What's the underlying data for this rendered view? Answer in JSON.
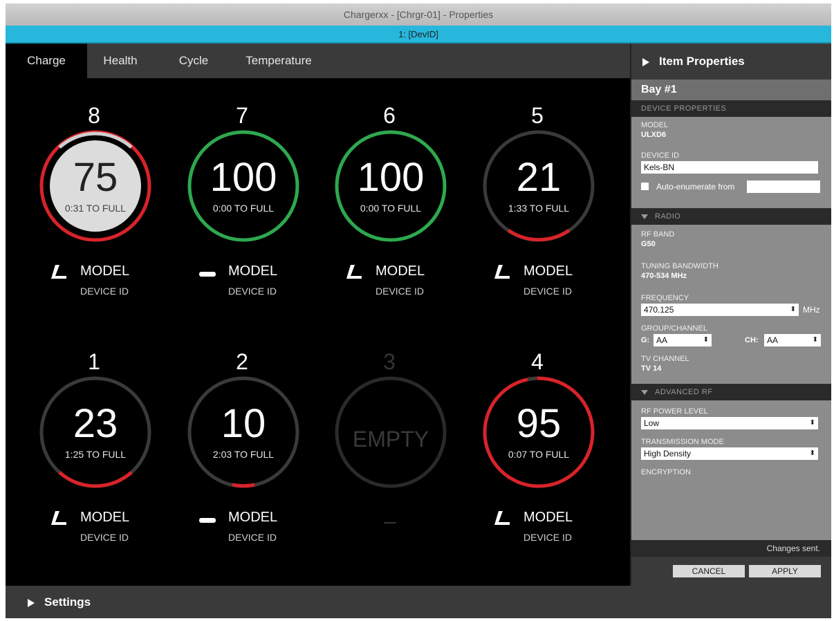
{
  "window": {
    "title": "Chargerxx - [Chrgr-01] - Properties"
  },
  "device_bar": {
    "label": "1: [DevID]"
  },
  "tabs": [
    {
      "label": "Charge",
      "active": true
    },
    {
      "label": "Health",
      "active": false
    },
    {
      "label": "Cycle",
      "active": false
    },
    {
      "label": "Temperature",
      "active": false
    }
  ],
  "colors": {
    "green": "#2ea84f",
    "red": "#d8232a",
    "track": "#3a3a3a",
    "accent": "#27b7dd"
  },
  "bays": [
    {
      "number": "8",
      "charge": "75",
      "time_to_full": "0:31 TO FULL",
      "model": "MODEL",
      "device_id": "DEVICE ID",
      "device_icon": "handheld-mic-icon",
      "selected": true
    },
    {
      "number": "7",
      "charge": "100",
      "time_to_full": "0:00 TO FULL",
      "model": "MODEL",
      "device_id": "DEVICE ID",
      "device_icon": "bodypack-icon"
    },
    {
      "number": "6",
      "charge": "100",
      "time_to_full": "0:00 TO FULL",
      "model": "MODEL",
      "device_id": "DEVICE ID",
      "device_icon": "handheld-mic-icon"
    },
    {
      "number": "5",
      "charge": "21",
      "time_to_full": "1:33 TO FULL",
      "model": "MODEL",
      "device_id": "DEVICE ID",
      "device_icon": "handheld-mic-icon"
    },
    {
      "number": "1",
      "charge": "23",
      "time_to_full": "1:25 TO FULL",
      "model": "MODEL",
      "device_id": "DEVICE ID",
      "device_icon": "handheld-mic-icon"
    },
    {
      "number": "2",
      "charge": "10",
      "time_to_full": "2:03 TO FULL",
      "model": "MODEL",
      "device_id": "DEVICE ID",
      "device_icon": "bodypack-icon"
    },
    {
      "number": "3",
      "charge": "EMPTY",
      "time_to_full": "",
      "model": "—",
      "device_id": "",
      "device_icon": "",
      "empty": true
    },
    {
      "number": "4",
      "charge": "95",
      "time_to_full": "0:07 TO FULL",
      "model": "MODEL",
      "device_id": "DEVICE ID",
      "device_icon": "handheld-mic-icon"
    }
  ],
  "panel": {
    "header": "Item Properties",
    "bay_title": "Bay #1",
    "device_properties": {
      "section": "DEVICE PROPERTIES",
      "model_label": "MODEL",
      "model_value": "ULXD6",
      "device_id_label": "DEVICE ID",
      "device_id_value": "Kels-BN",
      "auto_enumerate_label": "Auto-enumerate from",
      "auto_enumerate_value": ""
    },
    "radio": {
      "section": "RADIO",
      "rf_band_label": "RF BAND",
      "rf_band_value": "G50",
      "tuning_label": "TUNING BANDWIDTH",
      "tuning_value": "470-534 MHz",
      "frequency_label": "FREQUENCY",
      "frequency_value": "470.125",
      "frequency_unit": "MHz",
      "group_channel_label": "GROUP/CHANNEL",
      "group_label": "G:",
      "group_value": "AA",
      "channel_label": "CH:",
      "channel_value": "AA",
      "tv_channel_label": "TV CHANNEL",
      "tv_channel_value": "TV 14"
    },
    "advanced_rf": {
      "section": "ADVANCED RF",
      "power_label": "RF POWER LEVEL",
      "power_value": "Low",
      "mode_label": "TRANSMISSION MODE",
      "mode_value": "High Density",
      "encryption_label": "ENCRYPTION"
    },
    "status": "Changes sent.",
    "cancel_label": "CANCEL",
    "apply_label": "APPLY"
  },
  "settings": {
    "label": "Settings"
  }
}
